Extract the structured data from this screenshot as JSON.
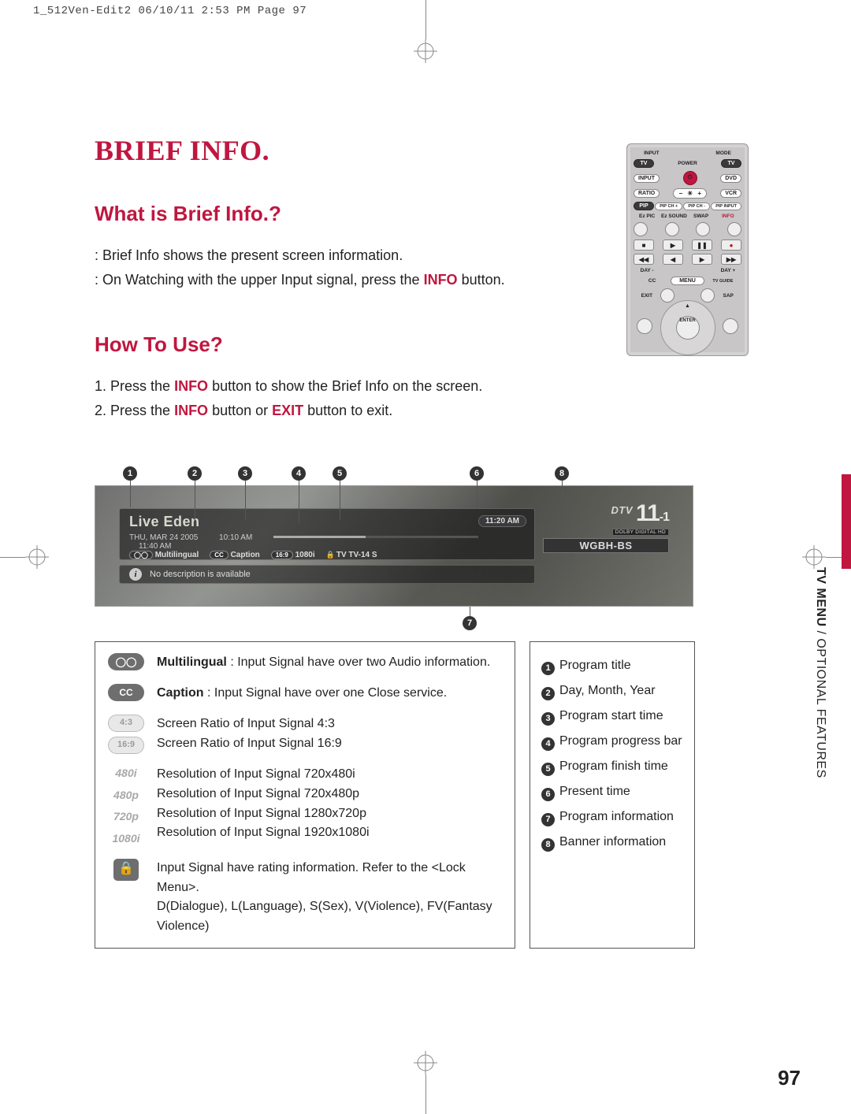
{
  "print_header": "1_512Ven-Edit2  06/10/11 2:53 PM  Page 97",
  "title": "BRIEF INFO.",
  "section1_title": "What is Brief Info.?",
  "section1_line1": ": Brief Info shows the present screen information.",
  "section1_line2a": ": On Watching with the upper Input signal, press the ",
  "section1_line2_info": "INFO",
  "section1_line2b": " button.",
  "section2_title": "How To Use?",
  "step1_a": "1. Press the ",
  "step1_info": "INFO",
  "step1_b": " button to show the Brief Info on the screen.",
  "step2_a": "2. Press the ",
  "step2_info": "INFO",
  "step2_b": " button or ",
  "step2_exit": "EXIT",
  "step2_c": " button to exit.",
  "remote": {
    "r1": {
      "input": "INPUT",
      "mode": "MODE"
    },
    "r2": {
      "tv1": "TV",
      "power": "POWER",
      "tv2": "TV"
    },
    "r3": {
      "input": "INPUT",
      "dvd": "DVD"
    },
    "r4": {
      "ratio": "RATIO",
      "minus": "−",
      "plus": "+",
      "vcr": "VCR"
    },
    "r5": {
      "pip": "PIP",
      "pipchp": "PIP CH +",
      "pipchm": "PIP CH -",
      "pipinput": "PIP INPUT"
    },
    "r6": {
      "ezpic": "Ez PIC",
      "ezsound": "Ez SOUND",
      "swap": "SWAP",
      "info": "INFO"
    },
    "media": {
      "stop": "■",
      "play": "▶",
      "pause": "❚❚",
      "rec": "●",
      "rew": "◀◀",
      "prev": "◀",
      "next": "▶",
      "fwd": "▶▶"
    },
    "r8": {
      "daym": "DAY -",
      "dayp": "DAY +"
    },
    "r9": {
      "cc": "CC",
      "menu": "MENU",
      "tvguide": "TV GUIDE"
    },
    "r10": {
      "exit": "EXIT",
      "sap": "SAP"
    },
    "enter": "ENTER"
  },
  "callouts": {
    "c1": "1",
    "c2": "2",
    "c3": "3",
    "c4": "4",
    "c5": "5",
    "c6": "6",
    "c7": "7",
    "c8": "8"
  },
  "osd": {
    "program_title": "Live Eden",
    "present_time": "11:20 AM",
    "date": "THU, MAR 24 2005",
    "start_time": "10:10 AM",
    "end_time": "11:40 AM",
    "multi_icon_label": "Multilingual",
    "cc_icon": "CC",
    "caption_label": "Caption",
    "ratio_icon": "16:9",
    "res_label": "1080i",
    "rating_label": "TV TV-14 S",
    "dtv": "DTV",
    "ch_main": "11",
    "ch_sub": "-1",
    "dolby": "DOLBY DIGITAL HD",
    "ch_name": "WGBH-BS",
    "desc": "No description is available",
    "info_i": "i"
  },
  "table": {
    "multi_title": "Multilingual",
    "multi_desc": " : Input Signal have over two Audio information.",
    "cc_icon": "CC",
    "caption_title": "Caption",
    "caption_desc": " : Input Signal have over one Close service.",
    "r43": "4:3",
    "r43_desc": "Screen Ratio of Input Signal 4:3",
    "r169": "16:9",
    "r169_desc": "Screen Ratio of Input Signal 16:9",
    "res480i": "480i",
    "res480i_desc": "Resolution of Input Signal 720x480i",
    "res480p": "480p",
    "res480p_desc": "Resolution of Input Signal 720x480p",
    "res720p": "720p",
    "res720p_desc": "Resolution of Input Signal 1280x720p",
    "res1080i": "1080i",
    "res1080i_desc": "Resolution of Input Signal 1920x1080i",
    "lock_desc1": "Input Signal have rating information. Refer to the <Lock Menu>.",
    "lock_desc2": "D(Dialogue), L(Language), S(Sex), V(Violence), FV(Fantasy Violence)"
  },
  "legend": {
    "n1": "Program title",
    "n2": "Day, Month, Year",
    "n3": "Program start time",
    "n4": "Program progress bar",
    "n5": "Program finish time",
    "n6": "Present time",
    "n7": "Program information",
    "n8": "Banner information"
  },
  "sidetext_bold": "TV MENU ",
  "sidetext_rest": "/ OPTIONAL FEATURES",
  "page_number": "97"
}
